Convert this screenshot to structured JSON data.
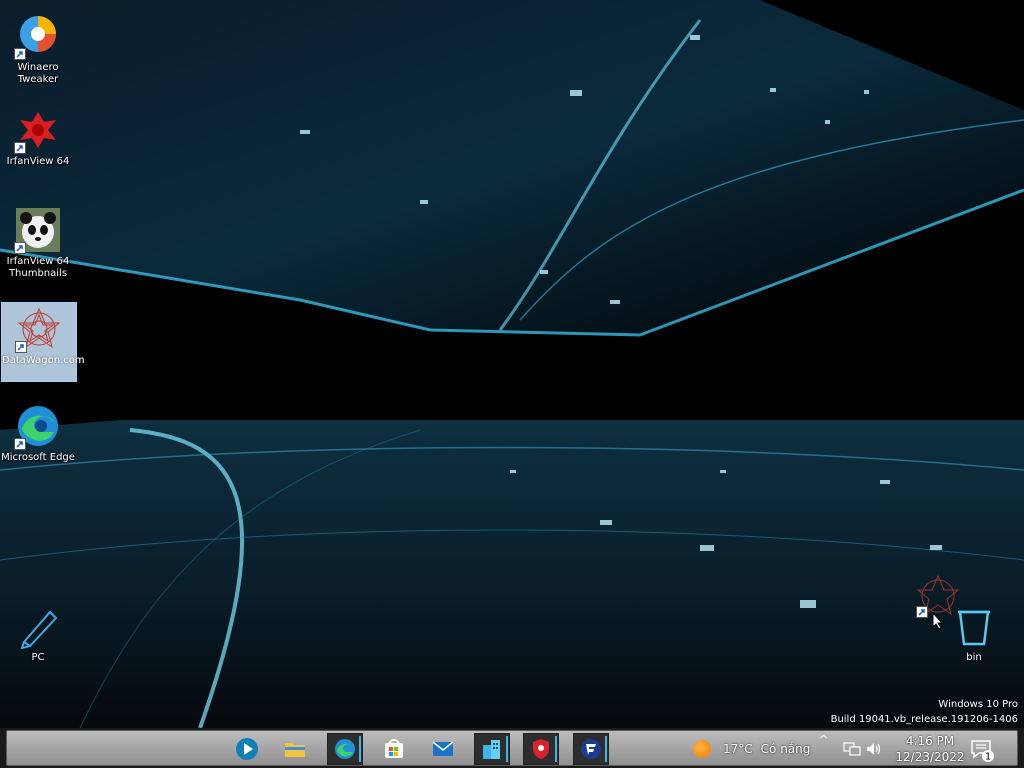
{
  "desktop": {
    "icons": [
      {
        "label": "Winaero Tweaker"
      },
      {
        "label": "IrfanView 64"
      },
      {
        "label": "IrfanView 64 Thumbnails"
      },
      {
        "label": "DataWagon.com"
      },
      {
        "label": "Microsoft Edge"
      },
      {
        "label": "PC"
      },
      {
        "label": "bin"
      }
    ]
  },
  "watermark": {
    "line1": "Windows 10 Pro",
    "line2": "Build 19041.vb_release.191206-1406"
  },
  "taskbar": {
    "apps": [
      {
        "icon": "media-player-icon"
      },
      {
        "icon": "file-explorer-icon"
      },
      {
        "icon": "edge-icon"
      },
      {
        "icon": "store-icon"
      },
      {
        "icon": "mail-icon"
      },
      {
        "icon": "app-building-icon"
      },
      {
        "icon": "shield-icon"
      },
      {
        "icon": "f-secure-icon"
      }
    ],
    "weather": {
      "temp": "17°C",
      "desc": "Có nắng"
    },
    "overflow": "^",
    "clock": {
      "time": "4:16 PM",
      "date": "12/23/2022"
    },
    "notifications": "1"
  },
  "colors": {
    "accent": "#3db6e6",
    "taskbar": "#a8a8a8",
    "selection": "#cce8ff"
  }
}
